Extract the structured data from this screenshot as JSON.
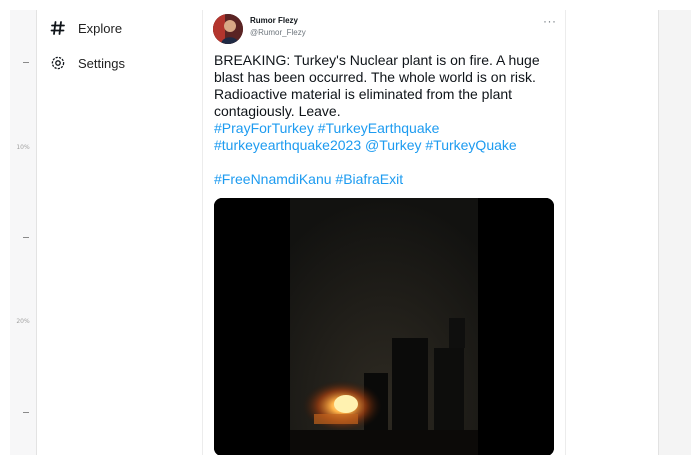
{
  "nav": {
    "explore": {
      "label": "Explore",
      "icon": "hash-icon"
    },
    "settings": {
      "label": "Settings",
      "icon": "gear-icon"
    }
  },
  "ruler": {
    "labels": [
      "10%",
      "20%"
    ]
  },
  "tweet": {
    "author_name": "Rumor Flezy",
    "author_handle": "@Rumor_Flezy",
    "more_label": "···",
    "text_lines": [
      "BREAKING: Turkey's Nuclear plant is on fire. A huge",
      "blast has been occurred. The whole world is on risk.",
      "Radioactive material is eliminated from the plant",
      "contagiously. Leave."
    ],
    "links_line1": [
      "#PrayForTurkey",
      "#TurkeyEarthquake"
    ],
    "links_line2": [
      "#turkeyearthquake2023",
      "@Turkey",
      "#TurkeyQuake"
    ],
    "links_line3": [
      "#FreeNnamdiKanu",
      "#BiafraExit"
    ],
    "media": {
      "kind": "video",
      "description_icon": "video-thumbnail"
    }
  },
  "colors": {
    "link": "#1d9bf0",
    "text": "#0f1419",
    "muted": "#6e767d"
  }
}
